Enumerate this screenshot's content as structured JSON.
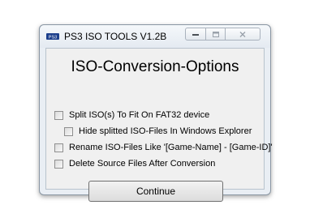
{
  "window": {
    "title": "PS3 ISO TOOLS V1.2B"
  },
  "dialog": {
    "heading": "ISO-Conversion-Options",
    "options": [
      {
        "label": "Split ISO(s) To Fit On FAT32 device",
        "checked": false
      },
      {
        "label": "Hide splitted ISO-Files In Windows Explorer",
        "checked": false
      },
      {
        "label": "Rename ISO-Files Like '[Game-Name] - [Game-ID]'",
        "checked": false
      },
      {
        "label": "Delete Source Files After Conversion",
        "checked": false
      }
    ],
    "continue_label": "Continue"
  },
  "icons": {
    "app": "ps3-logo-icon",
    "minimize": "minimize-icon",
    "maximize": "maximize-icon",
    "close": "close-icon"
  },
  "colors": {
    "window_frame": "#e9eef4",
    "client_bg": "#f0f0f0",
    "app_icon": "#1c3f8c"
  }
}
